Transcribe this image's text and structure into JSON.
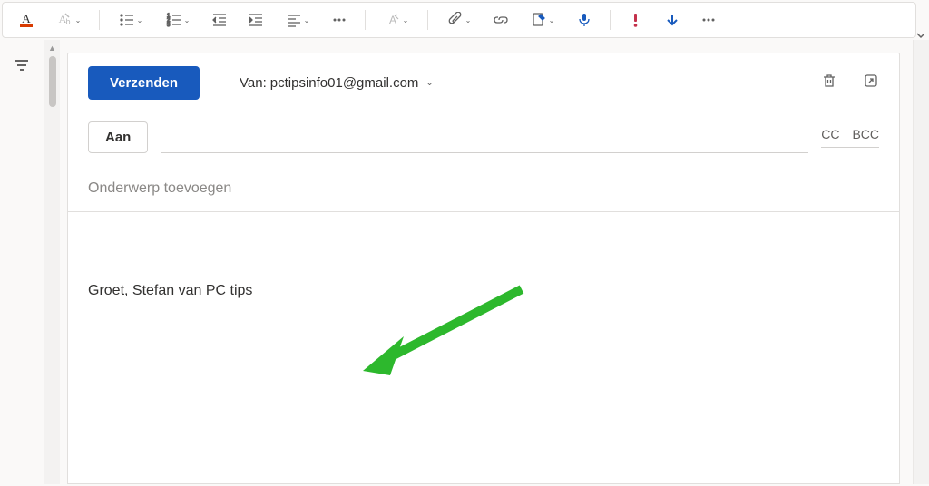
{
  "toolbar": {
    "font_color_icon": "A",
    "clear_formatting_icon": "Ab"
  },
  "compose": {
    "send_label": "Verzenden",
    "from_prefix": "Van:",
    "from_email": "pctipsinfo01@gmail.com",
    "to_label": "Aan",
    "cc_label": "CC",
    "bcc_label": "BCC",
    "subject_placeholder": "Onderwerp toevoegen",
    "signature": "Groet, Stefan van PC tips"
  }
}
